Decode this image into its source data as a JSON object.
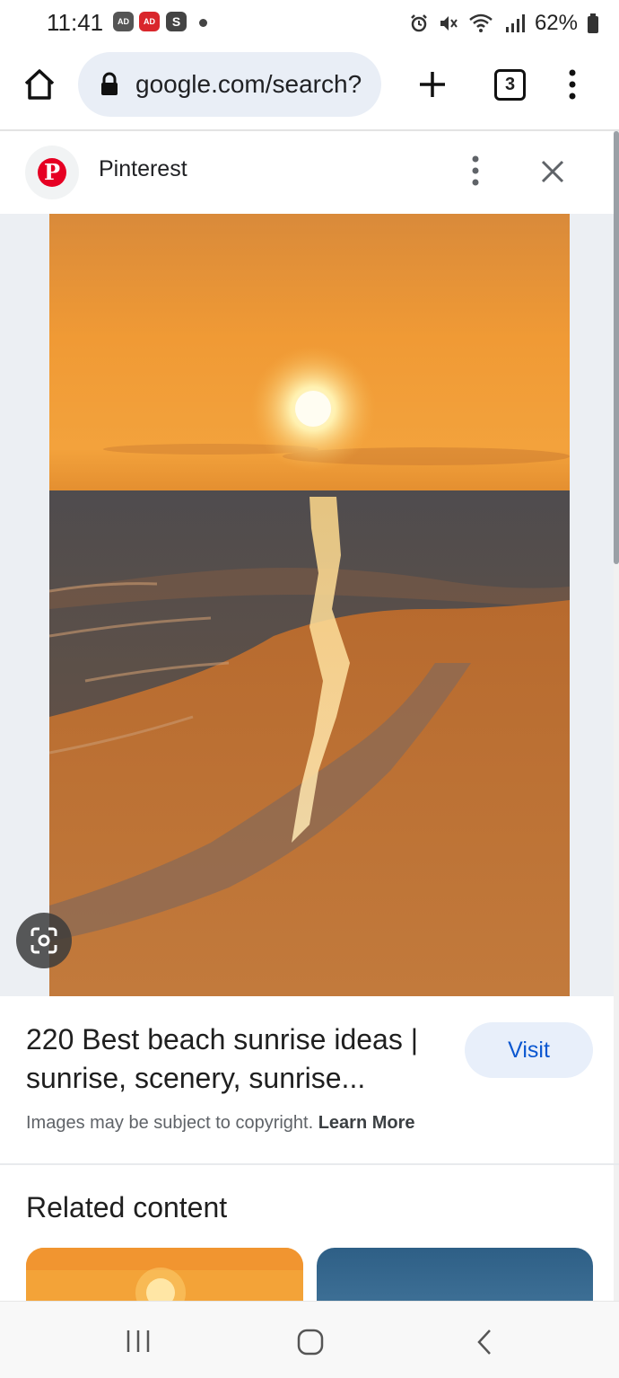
{
  "status_bar": {
    "time": "11:41",
    "badges": [
      "AD",
      "AD",
      "S"
    ],
    "battery": "62%"
  },
  "browser": {
    "url": "google.com/search?",
    "tab_count": "3"
  },
  "source": {
    "name": "Pinterest",
    "logo_letter": "P"
  },
  "result": {
    "title": "220 Best beach sunrise ideas | sunrise, scenery, sunrise...",
    "visit_label": "Visit",
    "copyright_text": "Images may be subject to copyright.",
    "learn_more": "Learn More"
  },
  "related": {
    "heading": "Related content"
  },
  "colors": {
    "accent": "#0b57d0",
    "visit_bg": "#e8effa",
    "pinterest": "#e60023"
  }
}
